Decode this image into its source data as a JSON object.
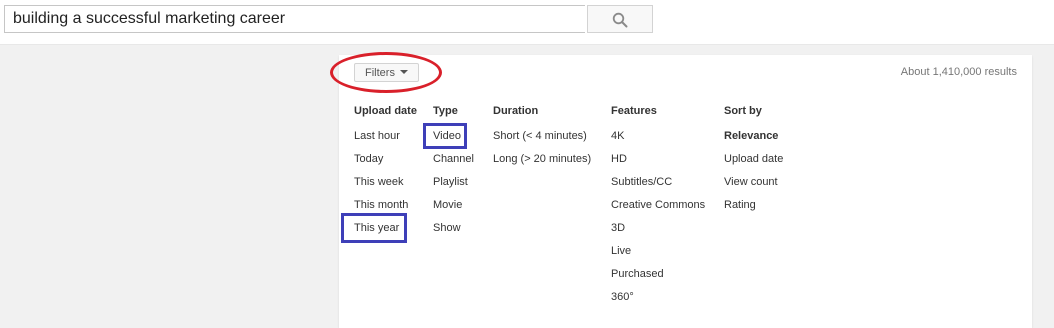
{
  "search": {
    "query": "building a successful marketing career",
    "button_icon": "search-icon"
  },
  "filters": {
    "button_label": "Filters",
    "caret_icon": "caret-down-icon",
    "results_count": "About 1,410,000 results"
  },
  "columns": {
    "upload_date": {
      "header": "Upload date",
      "items": [
        "Last hour",
        "Today",
        "This week",
        "This month",
        "This year"
      ]
    },
    "type": {
      "header": "Type",
      "items": [
        "Video",
        "Channel",
        "Playlist",
        "Movie",
        "Show"
      ]
    },
    "duration": {
      "header": "Duration",
      "items": [
        "Short (< 4 minutes)",
        "Long (> 20 minutes)"
      ]
    },
    "features": {
      "header": "Features",
      "items": [
        "4K",
        "HD",
        "Subtitles/CC",
        "Creative Commons",
        "3D",
        "Live",
        "Purchased",
        "360°"
      ]
    },
    "sort_by": {
      "header": "Sort by",
      "items": [
        "Relevance",
        "Upload date",
        "View count",
        "Rating"
      ]
    }
  },
  "colors": {
    "annotation_red": "#d9202a",
    "annotation_blue": "#3e3fb8",
    "page_background": "#f1f1f1"
  }
}
